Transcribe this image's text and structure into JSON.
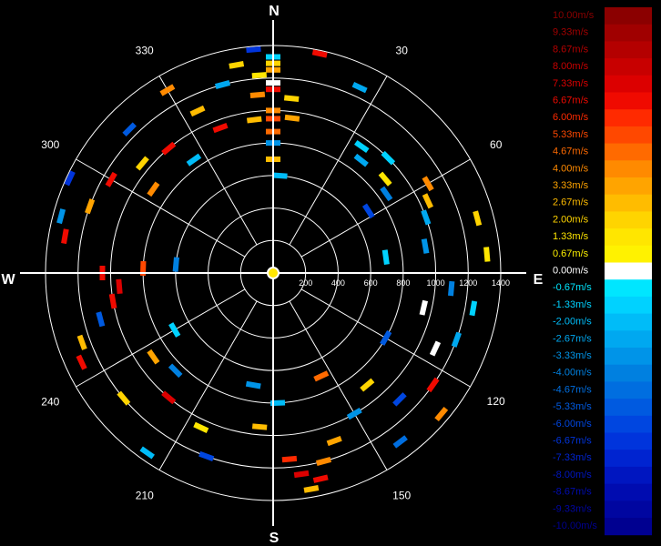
{
  "chart_data": {
    "type": "scatter",
    "subtype": "polar radial-velocity plot",
    "cardinal_labels": {
      "north": "N",
      "east": "E",
      "south": "S",
      "west": "W"
    },
    "angle_labels": [
      "30",
      "60",
      "120",
      "150",
      "210",
      "240",
      "300",
      "330"
    ],
    "angle_values": [
      30,
      60,
      120,
      150,
      210,
      240,
      300,
      330
    ],
    "range_ring_labels": [
      "200",
      "400",
      "600",
      "800",
      "1000",
      "1200",
      "1400"
    ],
    "range_ring_values": [
      200,
      400,
      600,
      800,
      1000,
      1200,
      1400
    ],
    "range_max": 1400,
    "grid": true,
    "spoke_step_deg": 30,
    "legend_position": "right",
    "colorbar": {
      "labels": [
        "10.00m/s",
        "9.33m/s",
        "8.67m/s",
        "8.00m/s",
        "7.33m/s",
        "6.67m/s",
        "6.00m/s",
        "5.33m/s",
        "4.67m/s",
        "4.00m/s",
        "3.33m/s",
        "2.67m/s",
        "2.00m/s",
        "1.33m/s",
        "0.67m/s",
        "0.00m/s",
        "-0.67m/s",
        "-1.33m/s",
        "-2.00m/s",
        "-2.67m/s",
        "-3.33m/s",
        "-4.00m/s",
        "-4.67m/s",
        "-5.33m/s",
        "-6.00m/s",
        "-6.67m/s",
        "-7.33m/s",
        "-8.00m/s",
        "-8.67m/s",
        "-9.33m/s",
        "-10.00m/s"
      ],
      "colors": [
        "#8b0000",
        "#a00000",
        "#b40000",
        "#c80000",
        "#dc0000",
        "#f00a00",
        "#ff2a00",
        "#ff4800",
        "#ff6a00",
        "#ff8a00",
        "#ffa400",
        "#ffbc00",
        "#ffd400",
        "#ffe600",
        "#fff200",
        "#ffffff",
        "#00e6ff",
        "#00d2ff",
        "#00bcf8",
        "#00a8f0",
        "#0094e8",
        "#0080e0",
        "#006ee0",
        "#005ae0",
        "#0046e0",
        "#0034dc",
        "#0024d0",
        "#0016c0",
        "#000cb0",
        "#0006a0",
        "#000090"
      ]
    },
    "points": [
      {
        "az": 0,
        "r": 1290,
        "v": 2.0
      },
      {
        "az": 0,
        "r": 1250,
        "v": 3.33
      },
      {
        "az": 0,
        "r": 1170,
        "v": 0.0
      },
      {
        "az": 0,
        "r": 1130,
        "v": 6.67
      },
      {
        "az": 0,
        "r": 1000,
        "v": 4.0
      },
      {
        "az": 0,
        "r": 950,
        "v": 5.33
      },
      {
        "az": 0,
        "r": 870,
        "v": 4.67
      },
      {
        "az": 0,
        "r": 800,
        "v": -3.33
      },
      {
        "az": 0,
        "r": 1330,
        "v": -1.33
      },
      {
        "az": 0,
        "r": 700,
        "v": 2.67
      },
      {
        "az": 6,
        "r": 1080,
        "v": 2.0
      },
      {
        "az": 7,
        "r": 960,
        "v": 3.33
      },
      {
        "az": -4,
        "r": 1220,
        "v": 1.33
      },
      {
        "az": -5,
        "r": 1100,
        "v": 4.0
      },
      {
        "az": -7,
        "r": 950,
        "v": 2.67
      },
      {
        "az": 4,
        "r": 600,
        "v": -2.0
      },
      {
        "az": 12,
        "r": 1380,
        "v": 6.67
      },
      {
        "az": 25,
        "r": 1260,
        "v": -2.67
      },
      {
        "az": 35,
        "r": 950,
        "v": -1.33
      },
      {
        "az": 38,
        "r": 880,
        "v": -2.67
      },
      {
        "az": 45,
        "r": 1000,
        "v": -1.33
      },
      {
        "az": 50,
        "r": 900,
        "v": 1.33
      },
      {
        "az": 55,
        "r": 850,
        "v": -4.0
      },
      {
        "az": 57,
        "r": 700,
        "v": -6.0
      },
      {
        "az": 60,
        "r": 1100,
        "v": 4.0
      },
      {
        "az": 65,
        "r": 1050,
        "v": 2.67
      },
      {
        "az": 70,
        "r": 1000,
        "v": -2.67
      },
      {
        "az": 75,
        "r": 1300,
        "v": 2.0
      },
      {
        "az": 80,
        "r": 950,
        "v": -3.33
      },
      {
        "az": 82,
        "r": 700,
        "v": -1.33
      },
      {
        "az": 85,
        "r": 1320,
        "v": 1.33
      },
      {
        "az": 95,
        "r": 1100,
        "v": -4.0
      },
      {
        "az": 100,
        "r": 1250,
        "v": -1.33
      },
      {
        "az": 103,
        "r": 950,
        "v": 0.0
      },
      {
        "az": 110,
        "r": 1200,
        "v": -2.67
      },
      {
        "az": 115,
        "r": 1100,
        "v": 0.0
      },
      {
        "az": 120,
        "r": 800,
        "v": -5.33
      },
      {
        "az": 125,
        "r": 1200,
        "v": 6.67
      },
      {
        "az": 130,
        "r": 1350,
        "v": 4.0
      },
      {
        "az": 135,
        "r": 1100,
        "v": -6.0
      },
      {
        "az": 140,
        "r": 900,
        "v": 2.0
      },
      {
        "az": 143,
        "r": 1300,
        "v": -4.67
      },
      {
        "az": 150,
        "r": 1000,
        "v": -3.33
      },
      {
        "az": 155,
        "r": 700,
        "v": 4.67
      },
      {
        "az": 160,
        "r": 1100,
        "v": 3.33
      },
      {
        "az": 165,
        "r": 1200,
        "v": 4.0
      },
      {
        "az": 167,
        "r": 1300,
        "v": 6.67
      },
      {
        "az": 170,
        "r": 1350,
        "v": 2.67
      },
      {
        "az": 172,
        "r": 1250,
        "v": 7.33
      },
      {
        "az": 175,
        "r": 1150,
        "v": 6.0
      },
      {
        "az": 178,
        "r": 800,
        "v": -2.0
      },
      {
        "az": 185,
        "r": 950,
        "v": 2.67
      },
      {
        "az": 190,
        "r": 700,
        "v": -3.33
      },
      {
        "az": 200,
        "r": 1200,
        "v": -6.0
      },
      {
        "az": 205,
        "r": 1050,
        "v": 1.33
      },
      {
        "az": 215,
        "r": 1350,
        "v": -2.0
      },
      {
        "az": 220,
        "r": 1000,
        "v": 7.33
      },
      {
        "az": 225,
        "r": 850,
        "v": -4.0
      },
      {
        "az": 230,
        "r": 1200,
        "v": 2.0
      },
      {
        "az": 235,
        "r": 900,
        "v": 3.33
      },
      {
        "az": 240,
        "r": 700,
        "v": -1.33
      },
      {
        "az": 245,
        "r": 1300,
        "v": 6.67
      },
      {
        "az": 250,
        "r": 1250,
        "v": 2.67
      },
      {
        "az": 255,
        "r": 1100,
        "v": -5.33
      },
      {
        "az": 260,
        "r": 1000,
        "v": 6.67
      },
      {
        "az": 265,
        "r": 950,
        "v": 7.33
      },
      {
        "az": 270,
        "r": 1050,
        "v": 6.67
      },
      {
        "az": 272,
        "r": 800,
        "v": 5.33
      },
      {
        "az": 275,
        "r": 600,
        "v": -4.0
      },
      {
        "az": 280,
        "r": 1300,
        "v": 6.67
      },
      {
        "az": 285,
        "r": 1350,
        "v": -3.33
      },
      {
        "az": 290,
        "r": 1200,
        "v": 3.33
      },
      {
        "az": 295,
        "r": 1380,
        "v": -6.67
      },
      {
        "az": 300,
        "r": 1150,
        "v": 6.67
      },
      {
        "az": 305,
        "r": 900,
        "v": 4.0
      },
      {
        "az": 310,
        "r": 1050,
        "v": 2.0
      },
      {
        "az": 315,
        "r": 1250,
        "v": -5.33
      },
      {
        "az": 320,
        "r": 1000,
        "v": 6.67
      },
      {
        "az": 325,
        "r": 850,
        "v": -2.0
      },
      {
        "az": 330,
        "r": 1300,
        "v": 4.0
      },
      {
        "az": 335,
        "r": 1100,
        "v": 2.67
      },
      {
        "az": 340,
        "r": 950,
        "v": 6.67
      },
      {
        "az": 345,
        "r": 1200,
        "v": -2.67
      },
      {
        "az": 350,
        "r": 1300,
        "v": 2.0
      },
      {
        "az": 355,
        "r": 1380,
        "v": -6.67
      }
    ]
  }
}
